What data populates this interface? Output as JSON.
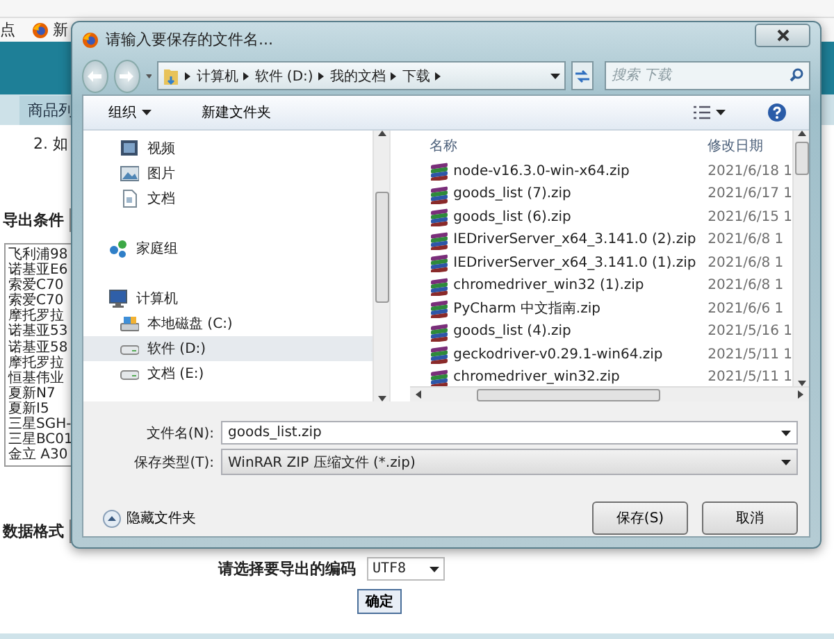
{
  "browser": {
    "bookmarks": [
      {
        "label": "点",
        "kind": "text"
      },
      {
        "label": "新",
        "kind": "firefox"
      }
    ]
  },
  "page": {
    "tab": "商品列",
    "notes": [
      "2. 如"
    ],
    "export_condition_label": "导出条件",
    "product_list": [
      "飞利浦98",
      "诺基亚E6",
      "索爱C70",
      "索爱C70",
      "摩托罗拉",
      "诺基亚53",
      "诺基亚58",
      "摩托罗拉",
      "恒基伟业",
      "夏新N7",
      "夏新I5",
      "三星SGH-",
      "三星BC01",
      "金立 A30"
    ],
    "data_format_label": "数据格式",
    "encoding_label": "请选择要导出的编码",
    "encoding_value": "UTF8",
    "confirm_button": "确定"
  },
  "dialog": {
    "title": "请输入要保存的文件名...",
    "breadcrumb": [
      "计算机",
      "软件 (D:)",
      "我的文档",
      "下载"
    ],
    "search": {
      "placeholder": "搜索 下载"
    },
    "toolbar": {
      "organize": "组织",
      "new_folder": "新建文件夹"
    },
    "nav_pane": {
      "items": [
        {
          "label": "视频",
          "kind": "video",
          "selected": false
        },
        {
          "label": "图片",
          "kind": "pictures",
          "selected": false
        },
        {
          "label": "文档",
          "kind": "documents",
          "selected": false
        },
        {
          "label": "家庭组",
          "kind": "homegroup",
          "selected": false
        },
        {
          "label": "计算机",
          "kind": "computer",
          "selected": false,
          "children": [
            {
              "label": "本地磁盘 (C:)",
              "kind": "system-drive",
              "selected": false
            },
            {
              "label": "软件 (D:)",
              "kind": "drive",
              "selected": true
            },
            {
              "label": "文档 (E:)",
              "kind": "drive",
              "selected": false
            }
          ]
        }
      ]
    },
    "file_list": {
      "columns": [
        "名称",
        "修改日期"
      ],
      "rows": [
        {
          "name": "node-v16.3.0-win-x64.zip",
          "modified": "2021/6/18 1"
        },
        {
          "name": "goods_list (7).zip",
          "modified": "2021/6/17 1"
        },
        {
          "name": "goods_list (6).zip",
          "modified": "2021/6/15 1"
        },
        {
          "name": "IEDriverServer_x64_3.141.0 (2).zip",
          "modified": "2021/6/8 1"
        },
        {
          "name": "IEDriverServer_x64_3.141.0 (1).zip",
          "modified": "2021/6/8 1"
        },
        {
          "name": "chromedriver_win32 (1).zip",
          "modified": "2021/6/8 1"
        },
        {
          "name": "PyCharm 中文指南.zip",
          "modified": "2021/6/6 1"
        },
        {
          "name": "goods_list (4).zip",
          "modified": "2021/5/16 1"
        },
        {
          "name": "geckodriver-v0.29.1-win64.zip",
          "modified": "2021/5/11 1"
        },
        {
          "name": "chromedriver_win32.zip",
          "modified": "2021/5/11 1"
        }
      ]
    },
    "file_name": {
      "label": "文件名(N):",
      "value": "goods_list.zip"
    },
    "save_type": {
      "label": "保存类型(T):",
      "value": "WinRAR ZIP 压缩文件 (*.zip)"
    },
    "hide_folders": "隐藏文件夹",
    "buttons": [
      "保存(S)",
      "取消"
    ]
  }
}
